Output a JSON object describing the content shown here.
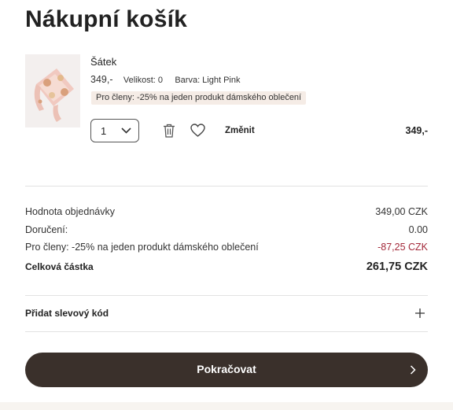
{
  "page_title": "Nákupní košík",
  "item": {
    "name": "Šátek",
    "price": "349,-",
    "size": "Velikost: 0",
    "color": "Barva: Light Pink",
    "promo": "Pro členy: -25% na jeden produkt dámského oblečení",
    "quantity": "1",
    "change_label": "Změnit",
    "line_total": "349,-",
    "image_icon": "scarf-product-image"
  },
  "summary": {
    "order_value_label": "Hodnota objednávky",
    "order_value": "349,00 CZK",
    "delivery_label": "Doručení:",
    "delivery_value": "0.00",
    "member_discount_label": "Pro členy: -25% na jeden produkt dámského oblečení",
    "member_discount_value": "-87,25 CZK",
    "total_label": "Celková částka",
    "total_value": "261,75 CZK"
  },
  "discount_code_label": "Přidat slevový kód",
  "continue_label": "Pokračovat",
  "colors": {
    "primary_button": "#3a302b",
    "discount_text": "#a3293a",
    "promo_badge_bg": "#f5ece6"
  }
}
